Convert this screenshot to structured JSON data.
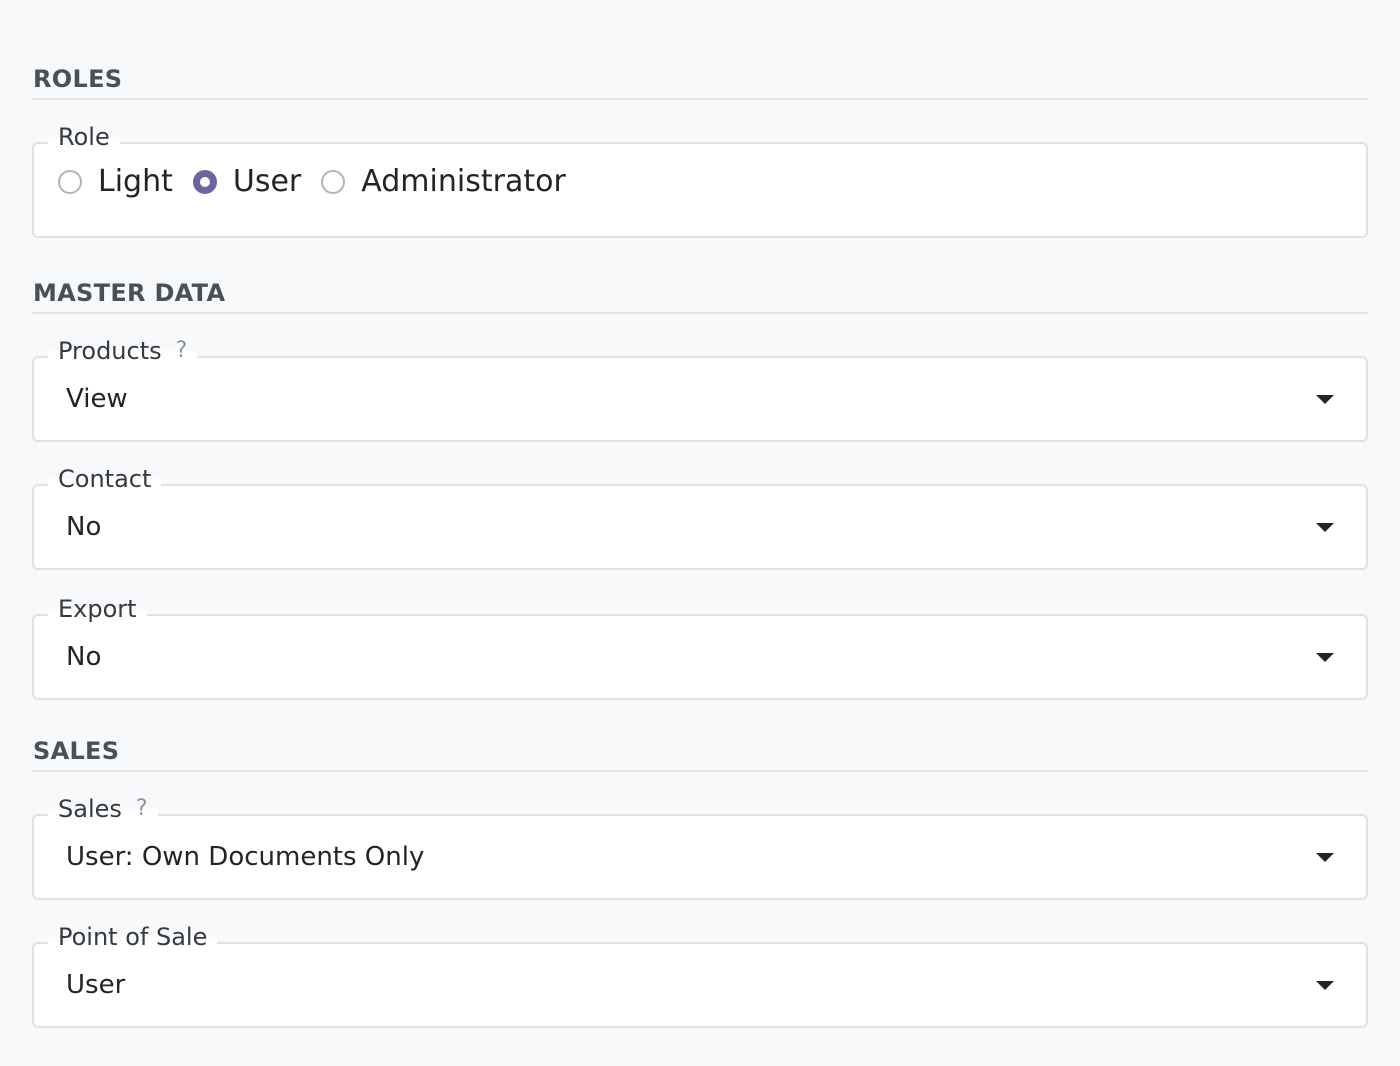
{
  "sections": {
    "roles": {
      "title": "ROLES"
    },
    "master_data": {
      "title": "MASTER DATA"
    },
    "sales": {
      "title": "SALES"
    }
  },
  "role_field": {
    "label": "Role",
    "options": [
      {
        "label": "Light",
        "checked": false
      },
      {
        "label": "User",
        "checked": true
      },
      {
        "label": "Administrator",
        "checked": false
      }
    ],
    "accent_color": "#71639e"
  },
  "products_field": {
    "label": "Products",
    "help": "?",
    "value": "View"
  },
  "contact_field": {
    "label": "Contact",
    "value": "No"
  },
  "export_field": {
    "label": "Export",
    "value": "No"
  },
  "sales_field": {
    "label": "Sales",
    "help": "?",
    "value": "User: Own Documents Only"
  },
  "pos_field": {
    "label": "Point of Sale",
    "value": "User"
  },
  "icons": {
    "radio": "radio-icon",
    "help": "question-mark-icon",
    "dropdown": "caret-down-icon"
  }
}
